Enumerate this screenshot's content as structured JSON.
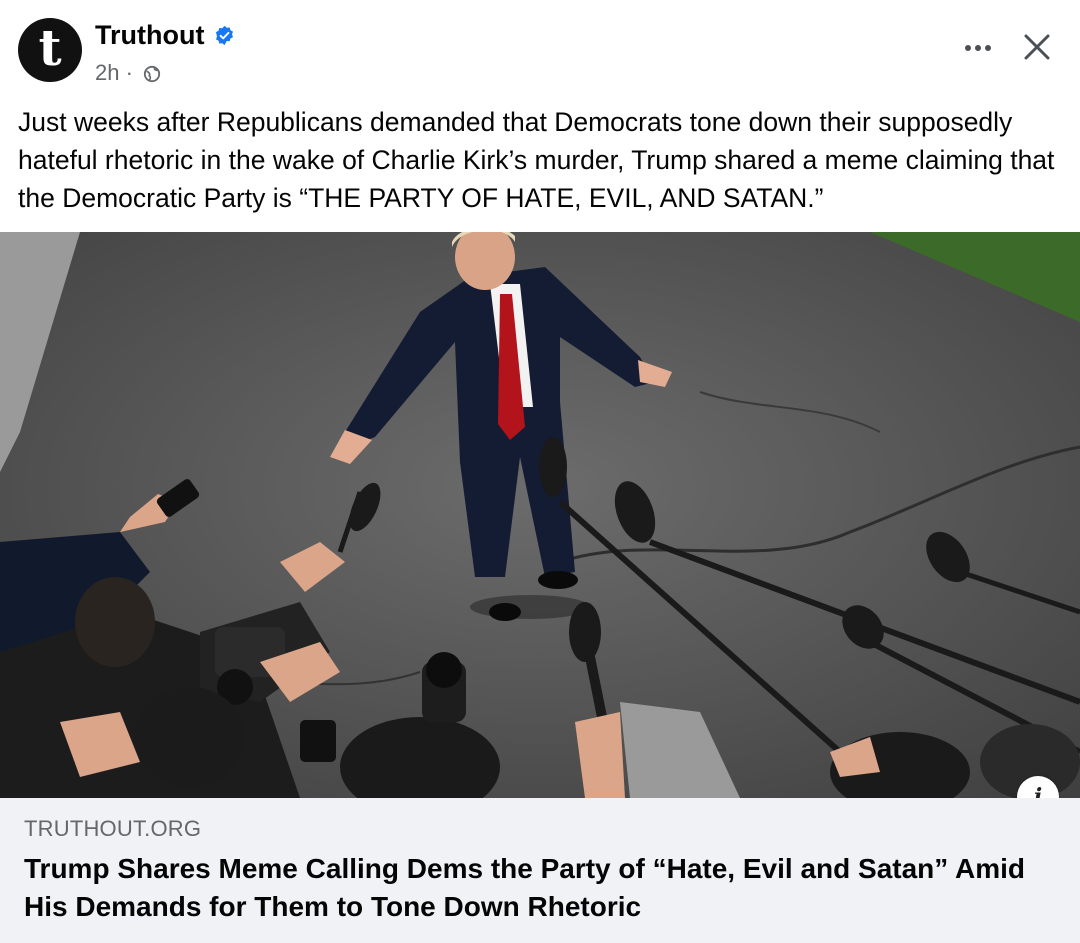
{
  "post": {
    "page_name": "Truthout",
    "avatar_letter": "t",
    "time": "2h",
    "separator": "·",
    "text": "Just weeks after Republicans demanded that Democrats tone down their supposedly hateful rhetoric in the wake of Charlie Kirk’s murder, Trump shared a meme claiming that the Democratic Party is “THE PARTY OF HATE, EVIL, AND SATAN.”"
  },
  "icons": {
    "verified": "verified-badge-icon",
    "globe": "globe-icon",
    "more": "more-options-icon",
    "close": "close-icon",
    "info": "info-icon"
  },
  "info_label": "i",
  "link": {
    "domain": "TRUTHOUT.ORG",
    "title": "Trump Shares Meme Calling Dems the Party of “Hate, Evil and Satan” Amid His Demands for Them to Tone Down Rhetoric"
  },
  "colors": {
    "verified": "#1877f2",
    "secondary_text": "#65676b",
    "card_background": "#f0f2f5"
  }
}
